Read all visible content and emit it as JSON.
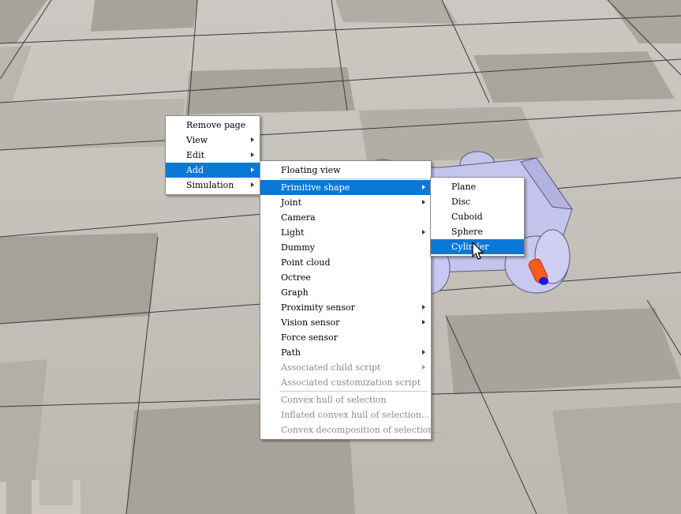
{
  "context_menu": {
    "items": [
      {
        "label": "Remove page",
        "submenu": false,
        "selected": false
      },
      {
        "label": "View",
        "submenu": true,
        "selected": false
      },
      {
        "label": "Edit",
        "submenu": true,
        "selected": false
      },
      {
        "label": "Add",
        "submenu": true,
        "selected": true
      },
      {
        "label": "Simulation",
        "submenu": true,
        "selected": false
      }
    ]
  },
  "add_menu": {
    "items": [
      {
        "label": "Floating view",
        "submenu": false,
        "selected": false,
        "disabled": false
      },
      {
        "label": "Primitive shape",
        "submenu": true,
        "selected": true,
        "disabled": false
      },
      {
        "label": "Joint",
        "submenu": true,
        "selected": false,
        "disabled": false
      },
      {
        "label": "Camera",
        "submenu": false,
        "selected": false,
        "disabled": false
      },
      {
        "label": "Light",
        "submenu": true,
        "selected": false,
        "disabled": false
      },
      {
        "label": "Dummy",
        "submenu": false,
        "selected": false,
        "disabled": false
      },
      {
        "label": "Point cloud",
        "submenu": false,
        "selected": false,
        "disabled": false
      },
      {
        "label": "Octree",
        "submenu": false,
        "selected": false,
        "disabled": false
      },
      {
        "label": "Graph",
        "submenu": false,
        "selected": false,
        "disabled": false
      },
      {
        "label": "Proximity sensor",
        "submenu": true,
        "selected": false,
        "disabled": false
      },
      {
        "label": "Vision sensor",
        "submenu": true,
        "selected": false,
        "disabled": false
      },
      {
        "label": "Force sensor",
        "submenu": false,
        "selected": false,
        "disabled": false
      },
      {
        "label": "Path",
        "submenu": true,
        "selected": false,
        "disabled": false
      },
      {
        "label": "Associated child script",
        "submenu": true,
        "selected": false,
        "disabled": true
      },
      {
        "label": "Associated customization script",
        "submenu": false,
        "selected": false,
        "disabled": true
      },
      {
        "label": "Convex hull of selection",
        "submenu": false,
        "selected": false,
        "disabled": true
      },
      {
        "label": "Inflated convex hull of selection...",
        "submenu": false,
        "selected": false,
        "disabled": true
      },
      {
        "label": "Convex decomposition of selection...",
        "submenu": false,
        "selected": false,
        "disabled": true
      }
    ]
  },
  "shape_menu": {
    "items": [
      {
        "label": "Plane",
        "selected": false
      },
      {
        "label": "Disc",
        "selected": false
      },
      {
        "label": "Cuboid",
        "selected": false
      },
      {
        "label": "Sphere",
        "selected": false
      },
      {
        "label": "Cylinder",
        "selected": true
      }
    ]
  },
  "colors": {
    "selection": "#0a78d7",
    "floor_light": "#d9d6cf",
    "floor_dark": "#a9a49b",
    "robot_body": "#c4c4ec",
    "cylinder": "#ff5a1e"
  }
}
